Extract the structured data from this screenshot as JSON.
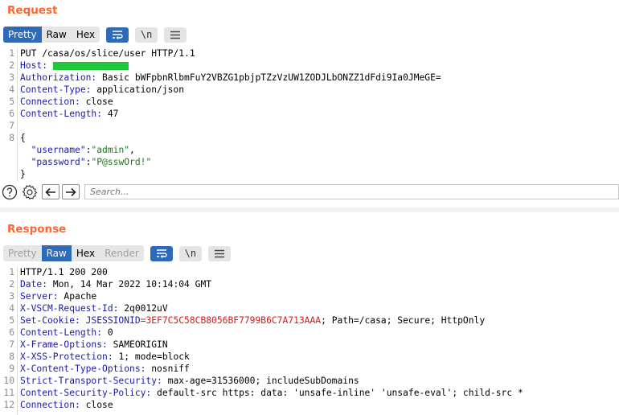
{
  "request": {
    "title": "Request",
    "tabs": [
      "Pretty",
      "Raw",
      "Hex"
    ],
    "newline_label": "\\n",
    "lines": [
      {
        "n": "1",
        "parts": [
          {
            "t": "PUT /casa/os/slice/user HTTP/1.1",
            "c": ""
          }
        ]
      },
      {
        "n": "2",
        "parts": [
          {
            "t": "Host: ",
            "c": "k"
          }
        ],
        "redacted": true
      },
      {
        "n": "3",
        "parts": [
          {
            "t": "Authorization: ",
            "c": "k"
          },
          {
            "t": "Basic bWFpbnRlbmFuY2VBZG1pbjpTZzVzUW1ZODJLbONZZ1dFdi9Ia0JMeGE=",
            "c": ""
          }
        ]
      },
      {
        "n": "4",
        "parts": [
          {
            "t": "Content-Type: ",
            "c": "k"
          },
          {
            "t": "application/json",
            "c": ""
          }
        ]
      },
      {
        "n": "5",
        "parts": [
          {
            "t": "Connection: ",
            "c": "k"
          },
          {
            "t": "close",
            "c": ""
          }
        ]
      },
      {
        "n": "6",
        "parts": [
          {
            "t": "Content-Length: ",
            "c": "k"
          },
          {
            "t": "47",
            "c": ""
          }
        ]
      },
      {
        "n": "7",
        "parts": []
      },
      {
        "n": "8",
        "parts": [
          {
            "t": "{",
            "c": ""
          }
        ]
      },
      {
        "n": "",
        "parts": [
          {
            "t": "  ",
            "c": ""
          },
          {
            "t": "\"username\"",
            "c": "k"
          },
          {
            "t": ":",
            "c": ""
          },
          {
            "t": "\"admin\"",
            "c": "str"
          },
          {
            "t": ",",
            "c": ""
          }
        ]
      },
      {
        "n": "",
        "parts": [
          {
            "t": "  ",
            "c": ""
          },
          {
            "t": "\"password\"",
            "c": "k"
          },
          {
            "t": ":",
            "c": ""
          },
          {
            "t": "\"P@sswOrd!\"",
            "c": "str"
          }
        ]
      },
      {
        "n": "",
        "parts": [
          {
            "t": "}",
            "c": ""
          }
        ]
      }
    ]
  },
  "search": {
    "placeholder": "Search..."
  },
  "response": {
    "title": "Response",
    "tabs": [
      "Pretty",
      "Raw",
      "Hex",
      "Render"
    ],
    "newline_label": "\\n",
    "lines": [
      {
        "n": "1",
        "parts": [
          {
            "t": "HTTP/1.1 200 200",
            "c": ""
          }
        ]
      },
      {
        "n": "2",
        "parts": [
          {
            "t": "Date: ",
            "c": "k"
          },
          {
            "t": "Mon, 14 Mar 2022 10:14:04 GMT",
            "c": ""
          }
        ]
      },
      {
        "n": "3",
        "parts": [
          {
            "t": "Server: ",
            "c": "k"
          },
          {
            "t": "Apache",
            "c": ""
          }
        ]
      },
      {
        "n": "4",
        "parts": [
          {
            "t": "X-VSCM-Request-Id: ",
            "c": "k"
          },
          {
            "t": "2q0012uV",
            "c": ""
          }
        ]
      },
      {
        "n": "5",
        "parts": [
          {
            "t": "Set-Cookie: ",
            "c": "k"
          },
          {
            "t": "JSESSIONID",
            "c": "k"
          },
          {
            "t": "=3EF7C5C58CB8056BF7799B6C7A713AAA",
            "c": "red"
          },
          {
            "t": "; Path=/casa; Secure; HttpOnly",
            "c": ""
          }
        ]
      },
      {
        "n": "6",
        "parts": [
          {
            "t": "Content-Length: ",
            "c": "k"
          },
          {
            "t": "0",
            "c": ""
          }
        ]
      },
      {
        "n": "7",
        "parts": [
          {
            "t": "X-Frame-Options: ",
            "c": "k"
          },
          {
            "t": "SAMEORIGIN",
            "c": ""
          }
        ]
      },
      {
        "n": "8",
        "parts": [
          {
            "t": "X-XSS-Protection: ",
            "c": "k"
          },
          {
            "t": "1; mode=block",
            "c": ""
          }
        ]
      },
      {
        "n": "9",
        "parts": [
          {
            "t": "X-Content-Type-Options: ",
            "c": "k"
          },
          {
            "t": "nosniff",
            "c": ""
          }
        ]
      },
      {
        "n": "10",
        "parts": [
          {
            "t": "Strict-Transport-Security: ",
            "c": "k"
          },
          {
            "t": "max-age=31536000; includeSubDomains",
            "c": ""
          }
        ]
      },
      {
        "n": "11",
        "parts": [
          {
            "t": "Content-Security-Policy: ",
            "c": "k"
          },
          {
            "t": "default-src https: data: 'unsafe-inline' 'unsafe-eval'; child-src *",
            "c": ""
          }
        ]
      },
      {
        "n": "12",
        "parts": [
          {
            "t": "Connection: ",
            "c": "k"
          },
          {
            "t": "close",
            "c": ""
          }
        ]
      }
    ]
  },
  "colors": {
    "accent": "#ff6633",
    "active_tab": "#2d6ab8",
    "header_key": "#1a1aa6",
    "cookie_value": "#d01b1b",
    "json_string": "#1a7a1a",
    "redaction": "#1ec83a"
  }
}
